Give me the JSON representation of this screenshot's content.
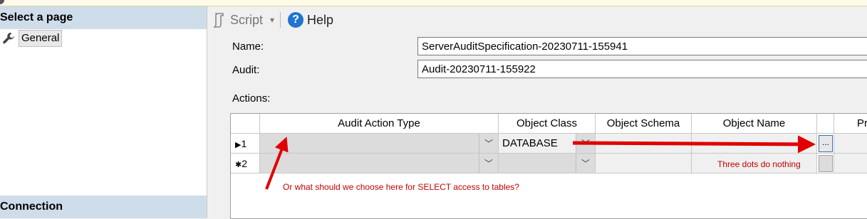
{
  "left_pane": {
    "select_header": "Select a page",
    "pages": [
      {
        "label": "General"
      }
    ],
    "connection_header": "Connection"
  },
  "toolbar": {
    "script_label": "Script",
    "help_label": "Help"
  },
  "form": {
    "name_label": "Name:",
    "name_value": "ServerAuditSpecification-20230711-155941",
    "audit_label": "Audit:",
    "audit_value": "Audit-20230711-155922",
    "actions_label": "Actions:"
  },
  "grid": {
    "columns": [
      "Audit Action Type",
      "Object Class",
      "Object Schema",
      "Object Name",
      "",
      "Pr"
    ],
    "rows": [
      {
        "row_header": "1",
        "marker": "▶",
        "audit_action_type": "",
        "object_class": "DATABASE",
        "object_schema": "",
        "object_name": "",
        "dots": "..."
      },
      {
        "row_header": "2",
        "marker": "✱",
        "audit_action_type": "",
        "object_class": "",
        "object_schema": "",
        "object_name": "",
        "dots": ""
      }
    ]
  },
  "annotations": {
    "dots_note": "Three dots do nothing",
    "select_note": "Or what should we choose here for SELECT access to tables?",
    "arrow_color": "#e00000"
  }
}
